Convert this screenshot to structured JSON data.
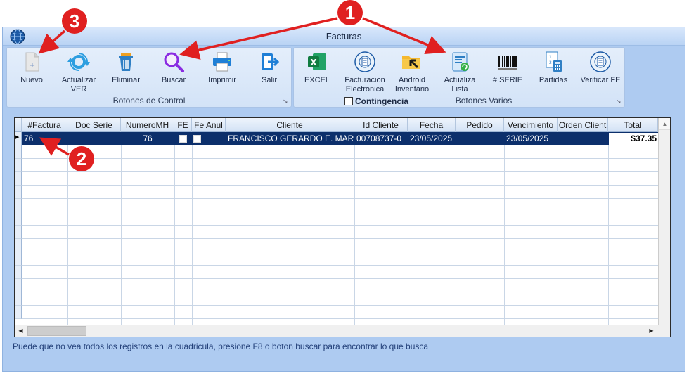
{
  "window": {
    "title": "Facturas"
  },
  "ribbon": {
    "control_group": {
      "title": "Botones de Control",
      "buttons": [
        {
          "id": "nuevo",
          "label": "Nuevo",
          "icon": "new-document-icon"
        },
        {
          "id": "actualizar",
          "label": "Actualizar\nVER",
          "icon": "refresh-icon"
        },
        {
          "id": "eliminar",
          "label": "Eliminar",
          "icon": "trash-icon"
        },
        {
          "id": "buscar",
          "label": "Buscar",
          "icon": "search-icon"
        },
        {
          "id": "imprimir",
          "label": "Imprimir",
          "icon": "printer-icon"
        },
        {
          "id": "salir",
          "label": "Salir",
          "icon": "exit-icon"
        }
      ]
    },
    "varios_group": {
      "title": "Botones Varios",
      "contingencia_label": "Contingencia",
      "buttons": [
        {
          "id": "excel",
          "label": "EXCEL",
          "icon": "excel-icon"
        },
        {
          "id": "facturacion",
          "label": "Facturacion\nElectronica",
          "icon": "e-invoice-seal-icon"
        },
        {
          "id": "android",
          "label": "Android\nInventario",
          "icon": "folder-arrow-icon"
        },
        {
          "id": "actualiza",
          "label": "Actualiza\nLista",
          "icon": "list-refresh-icon"
        },
        {
          "id": "serie",
          "label": "# SERIE",
          "icon": "barcode-icon"
        },
        {
          "id": "partidas",
          "label": "Partidas",
          "icon": "calculator-icon"
        },
        {
          "id": "verificar",
          "label": "Verificar FE",
          "icon": "e-invoice-seal-icon"
        }
      ]
    }
  },
  "grid": {
    "columns": [
      "#Factura",
      "Doc Serie",
      "NumeroMH",
      "FE",
      "Fe Anul",
      "Cliente",
      "Id Cliente",
      "Fecha",
      "Pedido",
      "Vencimiento",
      "Orden Client",
      "Total"
    ],
    "rows": [
      {
        "factura": "76",
        "doc_serie": "",
        "numero_mh": "76",
        "fe": false,
        "fe_anul": false,
        "cliente": "FRANCISCO GERARDO E. MARI",
        "id_cliente": "00708737-0",
        "fecha": "23/05/2025",
        "pedido": "",
        "vencimiento": "23/05/2025",
        "orden_cliente": "",
        "total": "$37.35"
      }
    ]
  },
  "status_text": "Puede que no vea todos los registros en la cuadricula, presione F8 o boton buscar para encontrar lo que busca",
  "annotations": [
    "1",
    "2",
    "3"
  ],
  "colors": {
    "selection": "#0c2f6b",
    "window_bg": "#aecbf1",
    "annotation": "#e02020"
  }
}
